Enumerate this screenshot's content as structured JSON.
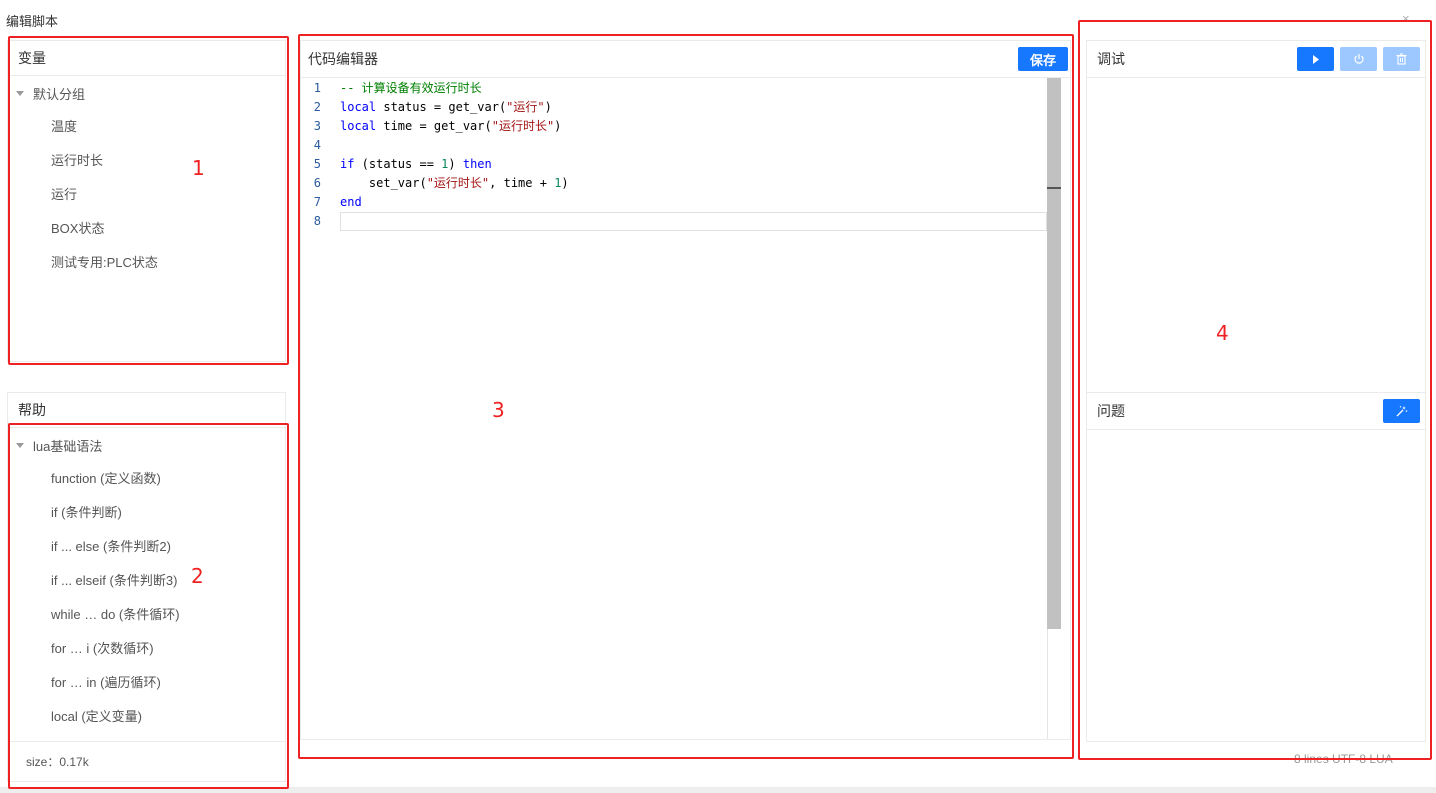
{
  "window": {
    "title": "编辑脚本",
    "close_glyph": "×"
  },
  "variables": {
    "title": "变量",
    "group": "默认分组",
    "items": [
      "温度",
      "运行时长",
      "运行",
      "BOX状态",
      "测试专用:PLC状态"
    ]
  },
  "help": {
    "title": "帮助",
    "group": "lua基础语法",
    "items": [
      "function (定义函数)",
      "if (条件判断)",
      "if ... else (条件判断2)",
      "if ... elseif (条件判断3)",
      "while … do (条件循环)",
      "for … i (次数循环)",
      "for … in (遍历循环)",
      "local (定义变量)"
    ],
    "size": "size：0.17k"
  },
  "editor": {
    "title": "代码编辑器",
    "save_label": "保存",
    "lines": [
      {
        "n": "1",
        "tokens": [
          [
            "c",
            "-- 计算设备有效运行时长"
          ]
        ]
      },
      {
        "n": "2",
        "tokens": [
          [
            "k",
            "local"
          ],
          [
            "p",
            " status = get_var("
          ],
          [
            "s",
            "\"运行\""
          ],
          [
            "p",
            ")"
          ]
        ]
      },
      {
        "n": "3",
        "tokens": [
          [
            "k",
            "local"
          ],
          [
            "p",
            " time = get_var("
          ],
          [
            "s",
            "\"运行时长\""
          ],
          [
            "p",
            ")"
          ]
        ]
      },
      {
        "n": "4",
        "tokens": []
      },
      {
        "n": "5",
        "tokens": [
          [
            "k",
            "if"
          ],
          [
            "p",
            " (status == "
          ],
          [
            "d",
            "1"
          ],
          [
            "p",
            ") "
          ],
          [
            "k",
            "then"
          ]
        ]
      },
      {
        "n": "6",
        "tokens": [
          [
            "p",
            "    set_var("
          ],
          [
            "s",
            "\"运行时长\""
          ],
          [
            "p",
            ", time + "
          ],
          [
            "d",
            "1"
          ],
          [
            "p",
            ")"
          ]
        ]
      },
      {
        "n": "7",
        "tokens": [
          [
            "k",
            "end"
          ]
        ]
      },
      {
        "n": "8",
        "tokens": []
      }
    ]
  },
  "debug": {
    "title": "调试",
    "icons": [
      "play-icon",
      "power-icon",
      "trash-icon"
    ]
  },
  "problems": {
    "title": "问题",
    "icons": [
      "magic-wand-icon"
    ]
  },
  "status_bar": "8 lines   UTF-8   LUA",
  "annotations": [
    "1",
    "2",
    "3",
    "4"
  ],
  "colors": {
    "accent": "#1677ff",
    "annotation": "#ee2222"
  }
}
